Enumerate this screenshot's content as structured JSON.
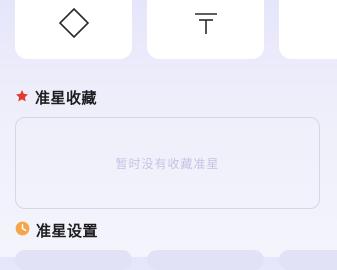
{
  "quick_actions": [
    {
      "icon": "diamond-icon"
    },
    {
      "icon": "cut-mark-icon"
    },
    {
      "icon": ""
    }
  ],
  "favorites": {
    "title": "准星收藏",
    "icon": "star-icon",
    "icon_color": "#e5392f",
    "empty_text": "暂时没有收藏准星"
  },
  "settings": {
    "title": "准星设置",
    "icon": "clock-icon",
    "icon_color": "#f5a64a"
  }
}
